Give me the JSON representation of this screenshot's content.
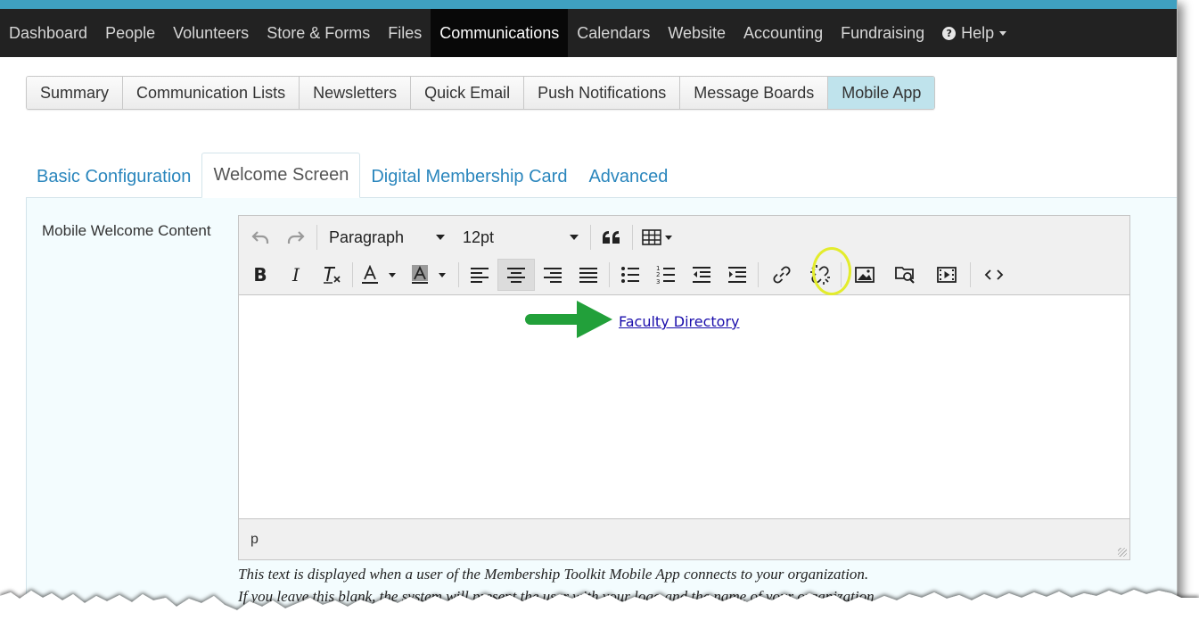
{
  "topnav": {
    "items": [
      "Dashboard",
      "People",
      "Volunteers",
      "Store & Forms",
      "Files",
      "Communications",
      "Calendars",
      "Website",
      "Accounting",
      "Fundraising"
    ],
    "active": "Communications",
    "help_label": "Help"
  },
  "subtabs": {
    "items": [
      "Summary",
      "Communication Lists",
      "Newsletters",
      "Quick Email",
      "Push Notifications",
      "Message Boards",
      "Mobile App"
    ],
    "active": "Mobile App"
  },
  "config_tabs": {
    "items": [
      "Basic Configuration",
      "Welcome Screen",
      "Digital Membership Card",
      "Advanced"
    ],
    "active": "Welcome Screen"
  },
  "field": {
    "label": "Mobile Welcome Content"
  },
  "editor": {
    "block_format": "Paragraph",
    "font_size": "12pt",
    "content_link": "Faculty Directory",
    "status_path": "p",
    "icons": {
      "undo": "undo-icon",
      "redo": "redo-icon",
      "blockquote": "blockquote-icon",
      "table": "table-icon",
      "bold": "bold-icon",
      "italic": "italic-icon",
      "clear_format": "clear-format-icon",
      "text_color": "text-color-icon",
      "bg_color": "background-color-icon",
      "align_left": "align-left-icon",
      "align_center": "align-center-icon",
      "align_right": "align-right-icon",
      "justify": "justify-icon",
      "bullet_list": "bullet-list-icon",
      "numbered_list": "numbered-list-icon",
      "outdent": "outdent-icon",
      "indent": "indent-icon",
      "link": "link-icon",
      "unlink": "unlink-icon",
      "image": "image-icon",
      "media_browser": "media-browser-icon",
      "video": "video-icon",
      "source_code": "source-code-icon"
    }
  },
  "help_text": {
    "line1": "This text is displayed when a user of the Membership Toolkit Mobile App connects to your organization.",
    "line2": "If you leave this blank, the system will present the user with your logo and the name of your organization."
  },
  "colors": {
    "topbar_bg": "#222222",
    "topbar_accent": "#3fa0c0",
    "active_subtab": "#bfe3ec",
    "tab_link": "#2a86bd",
    "annotation_arrow": "#22a03a",
    "annotation_ring": "#e3ec2c"
  }
}
